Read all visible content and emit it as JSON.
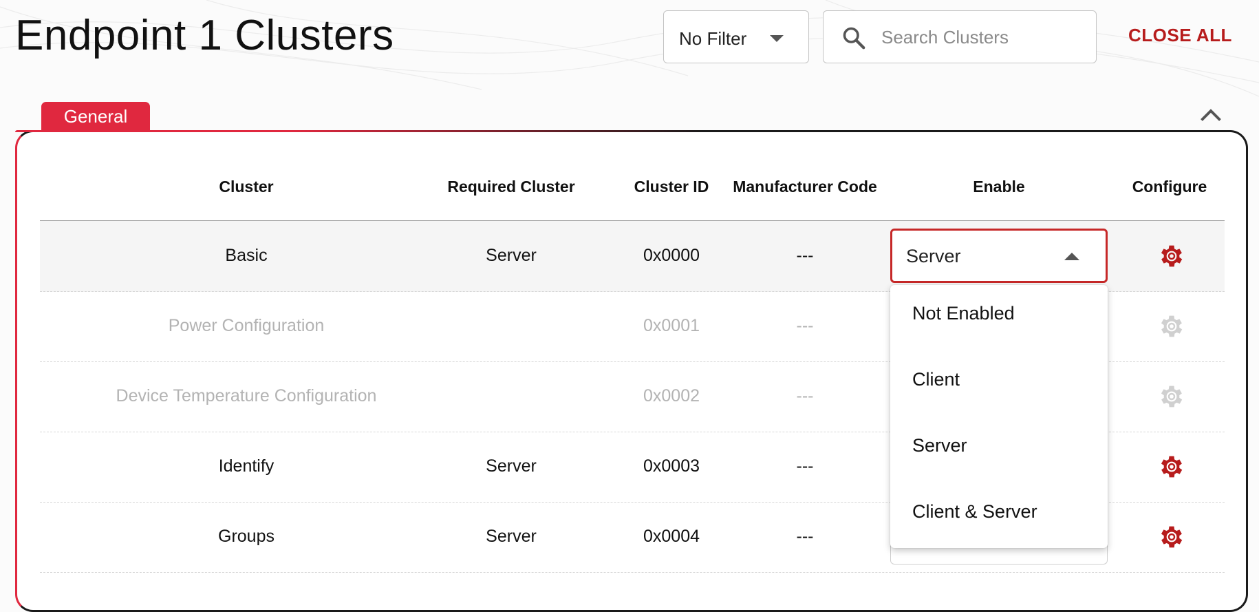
{
  "page": {
    "title": "Endpoint 1 Clusters"
  },
  "toolbar": {
    "filter_value": "No Filter",
    "search_placeholder": "Search Clusters",
    "close_all_label": "CLOSE ALL"
  },
  "group": {
    "label": "General"
  },
  "table": {
    "headers": [
      "Cluster",
      "Required Cluster",
      "Cluster ID",
      "Manufacturer Code",
      "Enable",
      "Configure"
    ],
    "rows": [
      {
        "cluster": "Basic",
        "required": "Server",
        "id": "0x0000",
        "mfg": "---",
        "enable": "Server",
        "state": "active"
      },
      {
        "cluster": "Power Configuration",
        "required": "",
        "id": "0x0001",
        "mfg": "---",
        "enable": "",
        "state": "disabled"
      },
      {
        "cluster": "Device Temperature Configuration",
        "required": "",
        "id": "0x0002",
        "mfg": "---",
        "enable": "",
        "state": "disabled"
      },
      {
        "cluster": "Identify",
        "required": "Server",
        "id": "0x0003",
        "mfg": "---",
        "enable": "",
        "state": "enabled"
      },
      {
        "cluster": "Groups",
        "required": "Server",
        "id": "0x0004",
        "mfg": "---",
        "enable": "",
        "state": "enabled"
      }
    ]
  },
  "enable_menu": {
    "options": [
      "Not Enabled",
      "Client",
      "Server",
      "Client & Server"
    ]
  },
  "colors": {
    "accent": "#c62828",
    "tab": "#e0283f",
    "gear_active": "#b71c1c",
    "gear_disabled": "#d0d0d0"
  },
  "icons": {
    "search": "search-icon",
    "gear": "gear-icon",
    "caret": "caret-icon",
    "collapse": "chevron-up-icon"
  }
}
